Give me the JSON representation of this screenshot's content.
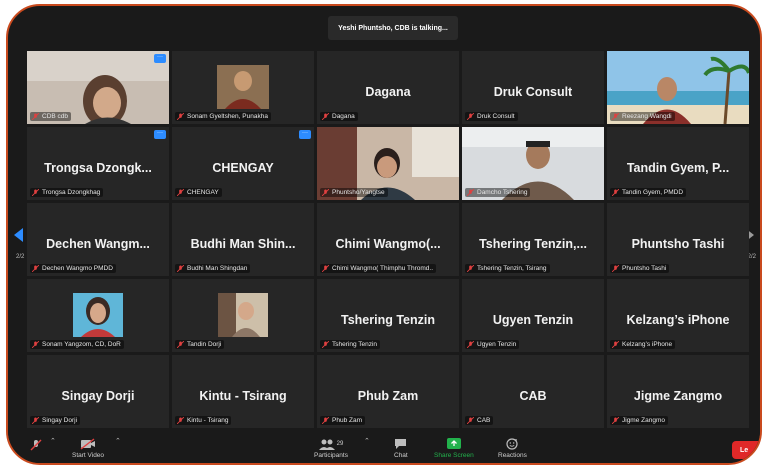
{
  "banner": {
    "talking": "Yeshi Phuntsho, CDB is talking..."
  },
  "pagination": {
    "left": "2/2",
    "right": "2/2"
  },
  "tiles": [
    {
      "big": "",
      "label": "CDB cdb"
    },
    {
      "big": "",
      "label": "Sonam Gyeltshen, Punakha"
    },
    {
      "big": "Dagana",
      "label": "Dagana"
    },
    {
      "big": "Druk Consult",
      "label": "Druk Consult"
    },
    {
      "big": "",
      "label": "Reezang Wangdi"
    },
    {
      "big": "Trongsa Dzongk...",
      "label": "Trongsa Dzongkhag"
    },
    {
      "big": "CHENGAY",
      "label": "CHENGAY"
    },
    {
      "big": "",
      "label": "Phuntsho/Yangtse"
    },
    {
      "big": "",
      "label": "Damcho Tshering"
    },
    {
      "big": "Tandin Gyem, P...",
      "label": "Tandin Gyem, PMDD"
    },
    {
      "big": "Dechen  Wangm...",
      "label": "Dechen Wangmo PMDD"
    },
    {
      "big": "Budhi Man Shin...",
      "label": "Budhi Man Shingdan"
    },
    {
      "big": "Chimi  Wangmo(...",
      "label": "Chimi Wangmo( Thimphu Thromd.."
    },
    {
      "big": "Tshering  Tenzin,...",
      "label": "Tshering Tenzin, Tsirang"
    },
    {
      "big": "Phuntsho Tashi",
      "label": "Phuntsho Tashi"
    },
    {
      "big": "",
      "label": "Sonam Yangzom, CD, DoR"
    },
    {
      "big": "",
      "label": "Tandin Dorji"
    },
    {
      "big": "Tshering Tenzin",
      "label": "Tshering Tenzin"
    },
    {
      "big": "Ugyen Tenzin",
      "label": "Ugyen Tenzin"
    },
    {
      "big": "Kelzang’s iPhone",
      "label": "Kelzang’s iPhone"
    },
    {
      "big": "Singay Dorji",
      "label": "Singay Dorji"
    },
    {
      "big": "Kintu - Tsirang",
      "label": "Kintu - Tsirang"
    },
    {
      "big": "Phub Zam",
      "label": "Phub Zam"
    },
    {
      "big": "CAB",
      "label": "CAB"
    },
    {
      "big": "Jigme Zangmo",
      "label": "Jigme Zangmo"
    }
  ],
  "toolbar": {
    "start_video": "Start Video",
    "participants": "Participants",
    "participants_count": "29",
    "chat": "Chat",
    "share_screen": "Share Screen",
    "reactions": "Reactions",
    "leave": "Le"
  },
  "colors": {
    "accent": "#2d8cff",
    "muted_mic": "#e04040",
    "share_green": "#22b24c",
    "leave_red": "#e02828"
  }
}
